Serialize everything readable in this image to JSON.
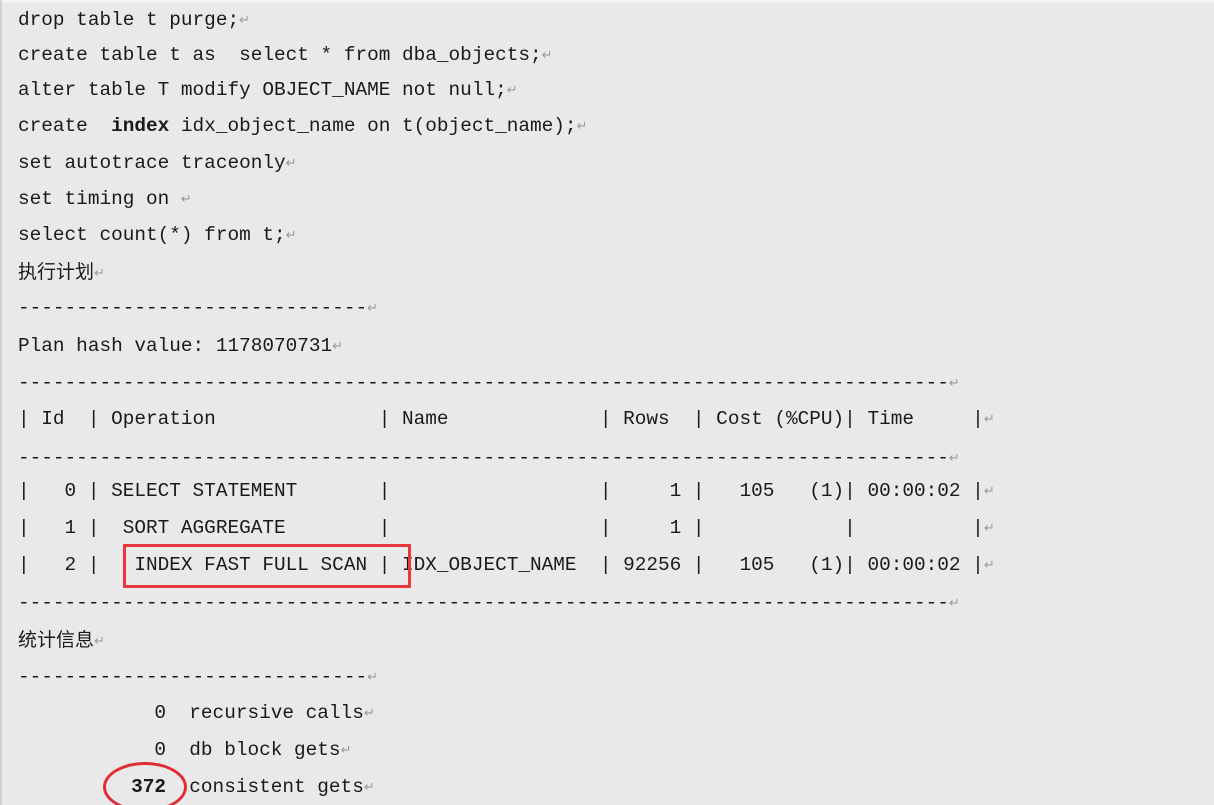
{
  "document": {
    "background_color": "#e9e9e9",
    "text_color": "#1a1a1a",
    "annotation_color": "#e8383d",
    "paragraph_mark": "↵"
  },
  "sql_script": [
    {
      "text": "drop table t purge;",
      "bold_word": null
    },
    {
      "text": "create table t as  select * from dba_objects;",
      "bold_word": null
    },
    {
      "text": "alter table T modify OBJECT_NAME not null;",
      "bold_word": null
    },
    {
      "pre": "create  ",
      "bold_word": "index",
      "post": " idx_object_name on t(object_name);"
    },
    {
      "text": "set autotrace traceonly",
      "bold_word": null
    },
    {
      "text": "set timing on ",
      "bold_word": null
    },
    {
      "text": "select count(*) from t;",
      "bold_word": null
    }
  ],
  "plan_section": {
    "heading": "执行计划",
    "short_rule": "------------------------------",
    "hash_label": "Plan hash value: 1178070731",
    "long_rule": "--------------------------------------------------------------------------------",
    "header_row": "| Id  | Operation              | Name             | Rows  | Cost (%CPU)| Time     |",
    "rows": [
      {
        "id": "0",
        "full": "|   0 | SELECT STATEMENT       |                  |     1 |   105   (1)| 00:00:02 |",
        "operation": "SELECT STATEMENT",
        "name": "",
        "rows": "1",
        "cost": "105",
        "cpu": "(1)",
        "time": "00:00:02"
      },
      {
        "id": "1",
        "full": "|   1 |  SORT AGGREGATE        |                  |     1 |            |          |",
        "operation": "SORT AGGREGATE",
        "name": "",
        "rows": "1",
        "cost": "",
        "cpu": "",
        "time": ""
      },
      {
        "id": "2",
        "full": "|   2 |   INDEX FAST FULL SCAN | IDX_OBJECT_NAME  | 92256 |   105   (1)| 00:00:02 |",
        "operation": "INDEX FAST FULL SCAN",
        "name": "IDX_OBJECT_NAME",
        "rows": "92256",
        "cost": "105",
        "cpu": "(1)",
        "time": "00:00:02"
      }
    ],
    "highlighted_operation": "INDEX FAST FULL SCAN"
  },
  "statistics_section": {
    "heading": "统计信息",
    "short_rule": "------------------------------",
    "entries": [
      {
        "value": "0",
        "label": "recursive calls",
        "highlighted": false
      },
      {
        "value": "0",
        "label": "db block gets",
        "highlighted": false
      },
      {
        "value": "372",
        "label": "consistent gets",
        "highlighted": true
      }
    ],
    "highlighted_value": "372"
  }
}
